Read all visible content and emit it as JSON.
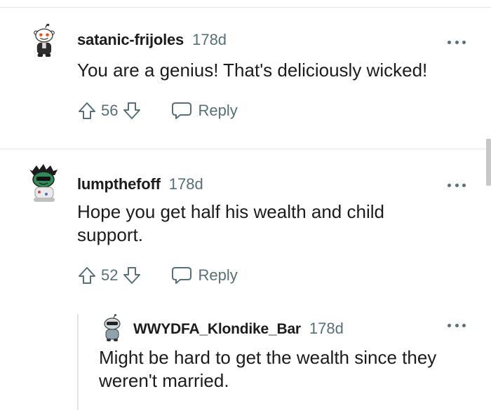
{
  "comments": [
    {
      "username": "satanic-frijoles",
      "age": "178d",
      "body": "You are a genius! That's deliciously wicked!",
      "score": "56",
      "reply_label": "Reply",
      "avatar_icon": "snoo-avatar-icon"
    },
    {
      "username": "lumpthefoff",
      "age": "178d",
      "body": "Hope you get half his wealth and child support.",
      "score": "52",
      "reply_label": "Reply",
      "avatar_icon": "snoo-avatar-icon"
    },
    {
      "username": "WWYDFA_Klondike_Bar",
      "age": "178d",
      "body": "Might be hard to get the wealth since they weren't married.",
      "avatar_icon": "snoo-avatar-icon"
    }
  ],
  "colors": {
    "meta_gray": "#576f76",
    "text": "#1c1c1c",
    "divider": "#e8e8e8"
  }
}
